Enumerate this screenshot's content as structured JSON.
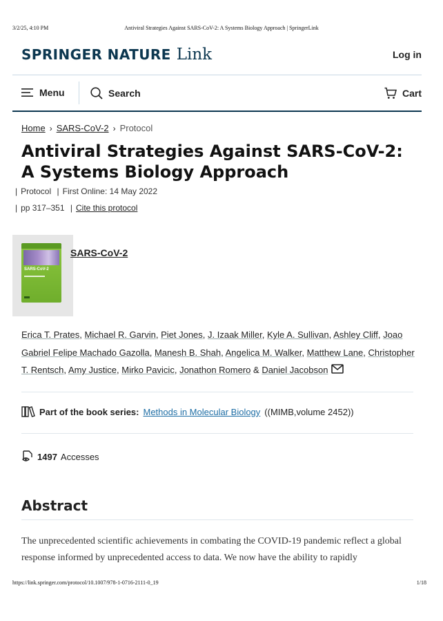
{
  "print_header": {
    "date": "3/2/25, 4:10 PM",
    "title": "Antiviral Strategies Against SARS-CoV-2: A Systems Biology Approach | SpringerLink"
  },
  "brand": {
    "springer_nature": "SPRINGER NATURE",
    "link": "Link",
    "color": "#0c3750"
  },
  "header": {
    "login": "Log in"
  },
  "nav": {
    "menu": "Menu",
    "search": "Search",
    "cart": "Cart"
  },
  "breadcrumb": {
    "home": "Home",
    "book": "SARS-CoV-2",
    "current": "Protocol"
  },
  "article": {
    "title": "Antiviral Strategies Against SARS-CoV-2: A Systems Biology Approach",
    "type": "Protocol",
    "first_online": "First Online: 14 May 2022",
    "pages": "pp 317–351",
    "cite": "Cite this protocol"
  },
  "book": {
    "title": "SARS-CoV-2",
    "cover_publisher": "Springer Protocols",
    "cover_title": "SARS-CoV-2",
    "cover_color": "#8cc63e"
  },
  "authors": [
    "Erica T. Prates",
    "Michael R. Garvin",
    "Piet Jones",
    "J. Izaak Miller",
    "Kyle A. Sullivan",
    "Ashley Cliff",
    "Joao Gabriel Felipe Machado Gazolla",
    "Manesh B. Shah",
    "Angelica M. Walker",
    "Matthew Lane",
    "Christopher T. Rentsch",
    "Amy Justice",
    "Mirko Pavicic",
    "Jonathon Romero",
    "Daniel Jacobson"
  ],
  "series": {
    "label": "Part of the book series:",
    "name": "Methods in Molecular Biology",
    "suffix": "((MIMB,volume 2452))"
  },
  "metrics": {
    "accesses_count": "1497",
    "accesses_label": "Accesses"
  },
  "abstract": {
    "heading": "Abstract",
    "text": "The unprecedented scientific achievements in combating the COVID-19 pandemic reflect a global response informed by unprecedented access to data. We now have the ability to rapidly"
  },
  "print_footer": {
    "url": "https://link.springer.com/protocol/10.1007/978-1-0716-2111-0_19",
    "page": "1/18"
  }
}
